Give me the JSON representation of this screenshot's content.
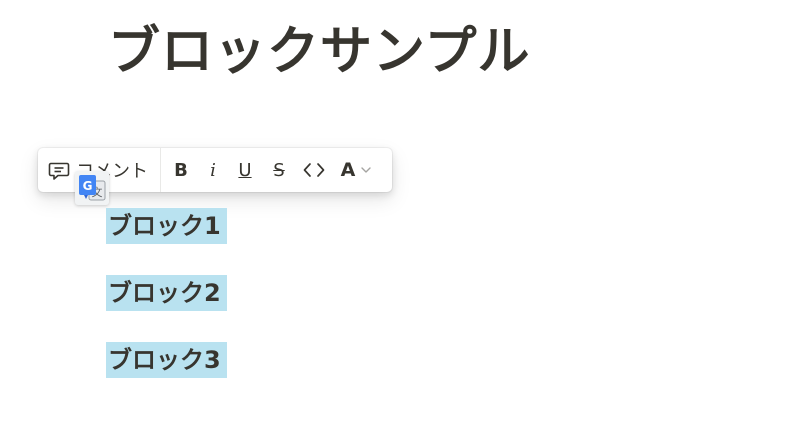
{
  "page": {
    "title": "ブロックサンプル"
  },
  "toolbar": {
    "comment_label": "コメント",
    "bold_label": "B",
    "italic_label": "i",
    "underline_label": "U",
    "strike_label": "S",
    "code_icon": "code-brackets-icon",
    "color_label": "A",
    "color_icon": "chevron-down-icon",
    "comment_icon": "comment-bubble-icon"
  },
  "overlay": {
    "translate_icon": "google-translate-icon"
  },
  "blocks": [
    {
      "text": "ブロック1",
      "selected": true
    },
    {
      "text": "ブロック2",
      "selected": true
    },
    {
      "text": "ブロック3",
      "selected": true
    }
  ],
  "colors": {
    "text": "#37352f",
    "selection": "#b9e2f0",
    "toolbar_bg": "#ffffff",
    "divider": "#e9e9e7",
    "translate_blue": "#4285f4"
  }
}
